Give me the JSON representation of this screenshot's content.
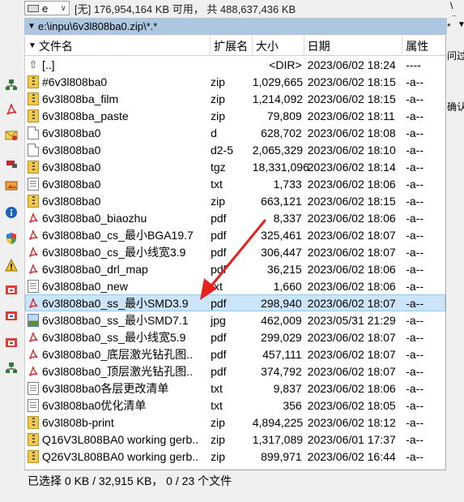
{
  "drive": {
    "letter": "e",
    "info": "[无] 176,954,164 KB 可用， 共 488,637,436 KB"
  },
  "path": {
    "text": "e:\\inpu\\6v3l808ba0.zip\\*.*"
  },
  "right_strip": {
    "backslash": "\\",
    "dotdot": "..",
    "star": "*",
    "hint_1": "问过",
    "hint_2": "确认"
  },
  "columns": {
    "name": "文件名",
    "ext": "扩展名",
    "size": "大小",
    "date": "日期",
    "attr": "属性"
  },
  "files": [
    {
      "name": "[..]",
      "ext": "",
      "size": "<DIR>",
      "date": "2023/06/02 18:24",
      "attr": "----",
      "icon": "up-icon"
    },
    {
      "name": "#6v3l808ba0",
      "ext": "zip",
      "size": "1,029,665",
      "date": "2023/06/02 18:15",
      "attr": "-a--",
      "icon": "zip-icon"
    },
    {
      "name": "6v3l808ba_film",
      "ext": "zip",
      "size": "1,214,092",
      "date": "2023/06/02 18:15",
      "attr": "-a--",
      "icon": "zip-icon"
    },
    {
      "name": "6v3l808ba_paste",
      "ext": "zip",
      "size": "79,809",
      "date": "2023/06/02 18:11",
      "attr": "-a--",
      "icon": "zip-icon"
    },
    {
      "name": "6v3l808ba0",
      "ext": "d",
      "size": "628,702",
      "date": "2023/06/02 18:08",
      "attr": "-a--",
      "icon": "file-icon"
    },
    {
      "name": "6v3l808ba0",
      "ext": "d2-5",
      "size": "2,065,329",
      "date": "2023/06/02 18:10",
      "attr": "-a--",
      "icon": "file-icon"
    },
    {
      "name": "6v3l808ba0",
      "ext": "tgz",
      "size": "18,331,096",
      "date": "2023/06/02 18:14",
      "attr": "-a--",
      "icon": "zip-icon"
    },
    {
      "name": "6v3l808ba0",
      "ext": "txt",
      "size": "1,733",
      "date": "2023/06/02 18:06",
      "attr": "-a--",
      "icon": "txt-icon"
    },
    {
      "name": "6v3l808ba0",
      "ext": "zip",
      "size": "663,121",
      "date": "2023/06/02 18:15",
      "attr": "-a--",
      "icon": "zip-icon"
    },
    {
      "name": "6v3l808ba0_biaozhu",
      "ext": "pdf",
      "size": "8,337",
      "date": "2023/06/02 18:06",
      "attr": "-a--",
      "icon": "pdf-icon"
    },
    {
      "name": "6v3l808ba0_cs_最小BGA19.7",
      "ext": "pdf",
      "size": "325,461",
      "date": "2023/06/02 18:07",
      "attr": "-a--",
      "icon": "pdf-icon"
    },
    {
      "name": "6v3l808ba0_cs_最小线宽3.9",
      "ext": "pdf",
      "size": "306,447",
      "date": "2023/06/02 18:07",
      "attr": "-a--",
      "icon": "pdf-icon"
    },
    {
      "name": "6v3l808ba0_drl_map",
      "ext": "pdf",
      "size": "36,215",
      "date": "2023/06/02 18:06",
      "attr": "-a--",
      "icon": "pdf-icon"
    },
    {
      "name": "6v3l808ba0_new",
      "ext": "txt",
      "size": "1,660",
      "date": "2023/06/02 18:06",
      "attr": "-a--",
      "icon": "txt-icon"
    },
    {
      "name": "6v3l808ba0_ss_最小SMD3.9",
      "ext": "pdf",
      "size": "298,940",
      "date": "2023/06/02 18:07",
      "attr": "-a--",
      "icon": "pdf-icon",
      "selected": true
    },
    {
      "name": "6v3l808ba0_ss_最小SMD7.1",
      "ext": "jpg",
      "size": "462,009",
      "date": "2023/05/31 21:29",
      "attr": "-a--",
      "icon": "image-icon"
    },
    {
      "name": "6v3l808ba0_ss_最小线宽5.9",
      "ext": "pdf",
      "size": "299,029",
      "date": "2023/06/02 18:07",
      "attr": "-a--",
      "icon": "pdf-icon"
    },
    {
      "name": "6v3l808ba0_底层激光钻孔图..",
      "ext": "pdf",
      "size": "457,111",
      "date": "2023/06/02 18:07",
      "attr": "-a--",
      "icon": "pdf-icon"
    },
    {
      "name": "6v3l808ba0_顶层激光钻孔图..",
      "ext": "pdf",
      "size": "374,792",
      "date": "2023/06/02 18:07",
      "attr": "-a--",
      "icon": "pdf-icon"
    },
    {
      "name": "6v3l808ba0各层更改清单",
      "ext": "txt",
      "size": "9,837",
      "date": "2023/06/02 18:06",
      "attr": "-a--",
      "icon": "txt-icon"
    },
    {
      "name": "6v3l808ba0优化清单",
      "ext": "txt",
      "size": "356",
      "date": "2023/06/02 18:05",
      "attr": "-a--",
      "icon": "txt-icon"
    },
    {
      "name": "6v3l808b-print",
      "ext": "zip",
      "size": "4,894,225",
      "date": "2023/06/02 18:12",
      "attr": "-a--",
      "icon": "zip-icon"
    },
    {
      "name": "Q16V3L808BA0 working gerb..",
      "ext": "zip",
      "size": "1,317,089",
      "date": "2023/06/01 17:37",
      "attr": "-a--",
      "icon": "zip-icon"
    },
    {
      "name": "Q26V3L808BA0 working gerb..",
      "ext": "zip",
      "size": "899,971",
      "date": "2023/06/02 16:44",
      "attr": "-a--",
      "icon": "zip-icon"
    }
  ],
  "status": {
    "text": "已选择 0 KB / 32,915 KB， 0 / 23 个文件"
  },
  "colors": {
    "path_bg": "#aec7e0",
    "selection_bg": "#cce4f7",
    "annotation_arrow": "#e8201c"
  },
  "left_toolbar_icons": [
    "network-icon",
    "pdf-icon",
    "mail-icon",
    "disconnect-icon",
    "image-icon",
    "info-icon",
    "shield-icon",
    "warning-icon",
    "package-icon",
    "package-icon",
    "package-icon",
    "network-icon"
  ]
}
